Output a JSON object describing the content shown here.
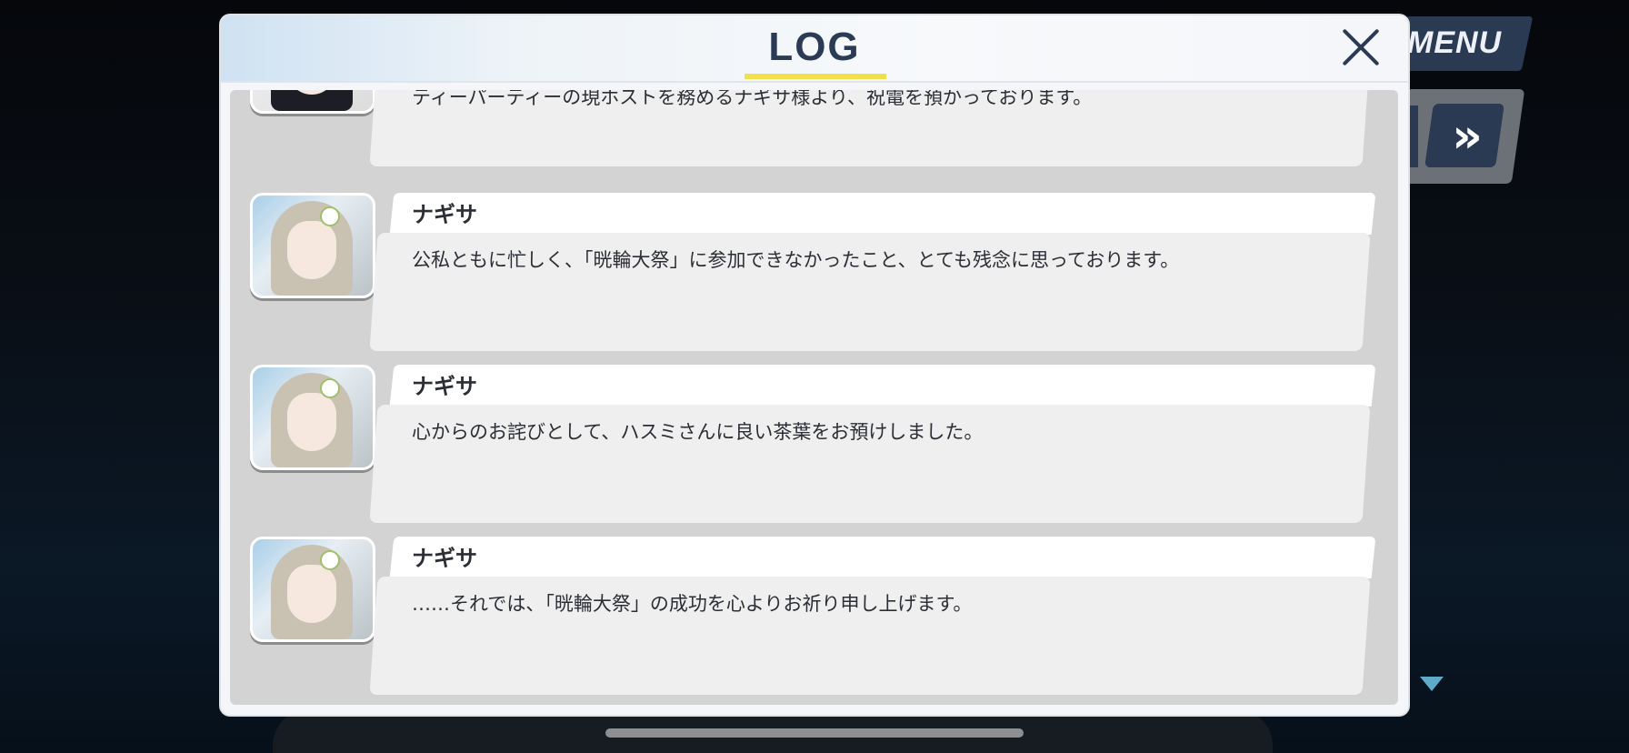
{
  "header": {
    "title": "LOG"
  },
  "hud": {
    "menu_label": "MENU",
    "skip_glyph": "»"
  },
  "colors": {
    "accent_underline": "#f1e04a",
    "title_text": "#2b3a55",
    "hud_button": "#2a3a52"
  },
  "icons": {
    "close": "close-icon",
    "skip": "fast-forward-icon",
    "scroll": "triangle-down-icon"
  },
  "log": {
    "top_entry": {
      "text": "ティーパーティーの現ホストを務めるナギサ様より、祝電を預かっております。"
    },
    "entries": [
      {
        "name": "ナギサ",
        "text": "公私ともに忙しく、「晄輪大祭」に参加できなかったこと、とても残念に思っております。"
      },
      {
        "name": "ナギサ",
        "text": "心からのお詫びとして、ハスミさんに良い茶葉をお預けしました。"
      },
      {
        "name": "ナギサ",
        "text": "……それでは、「晄輪大祭」の成功を心よりお祈り申し上げます。"
      }
    ]
  }
}
